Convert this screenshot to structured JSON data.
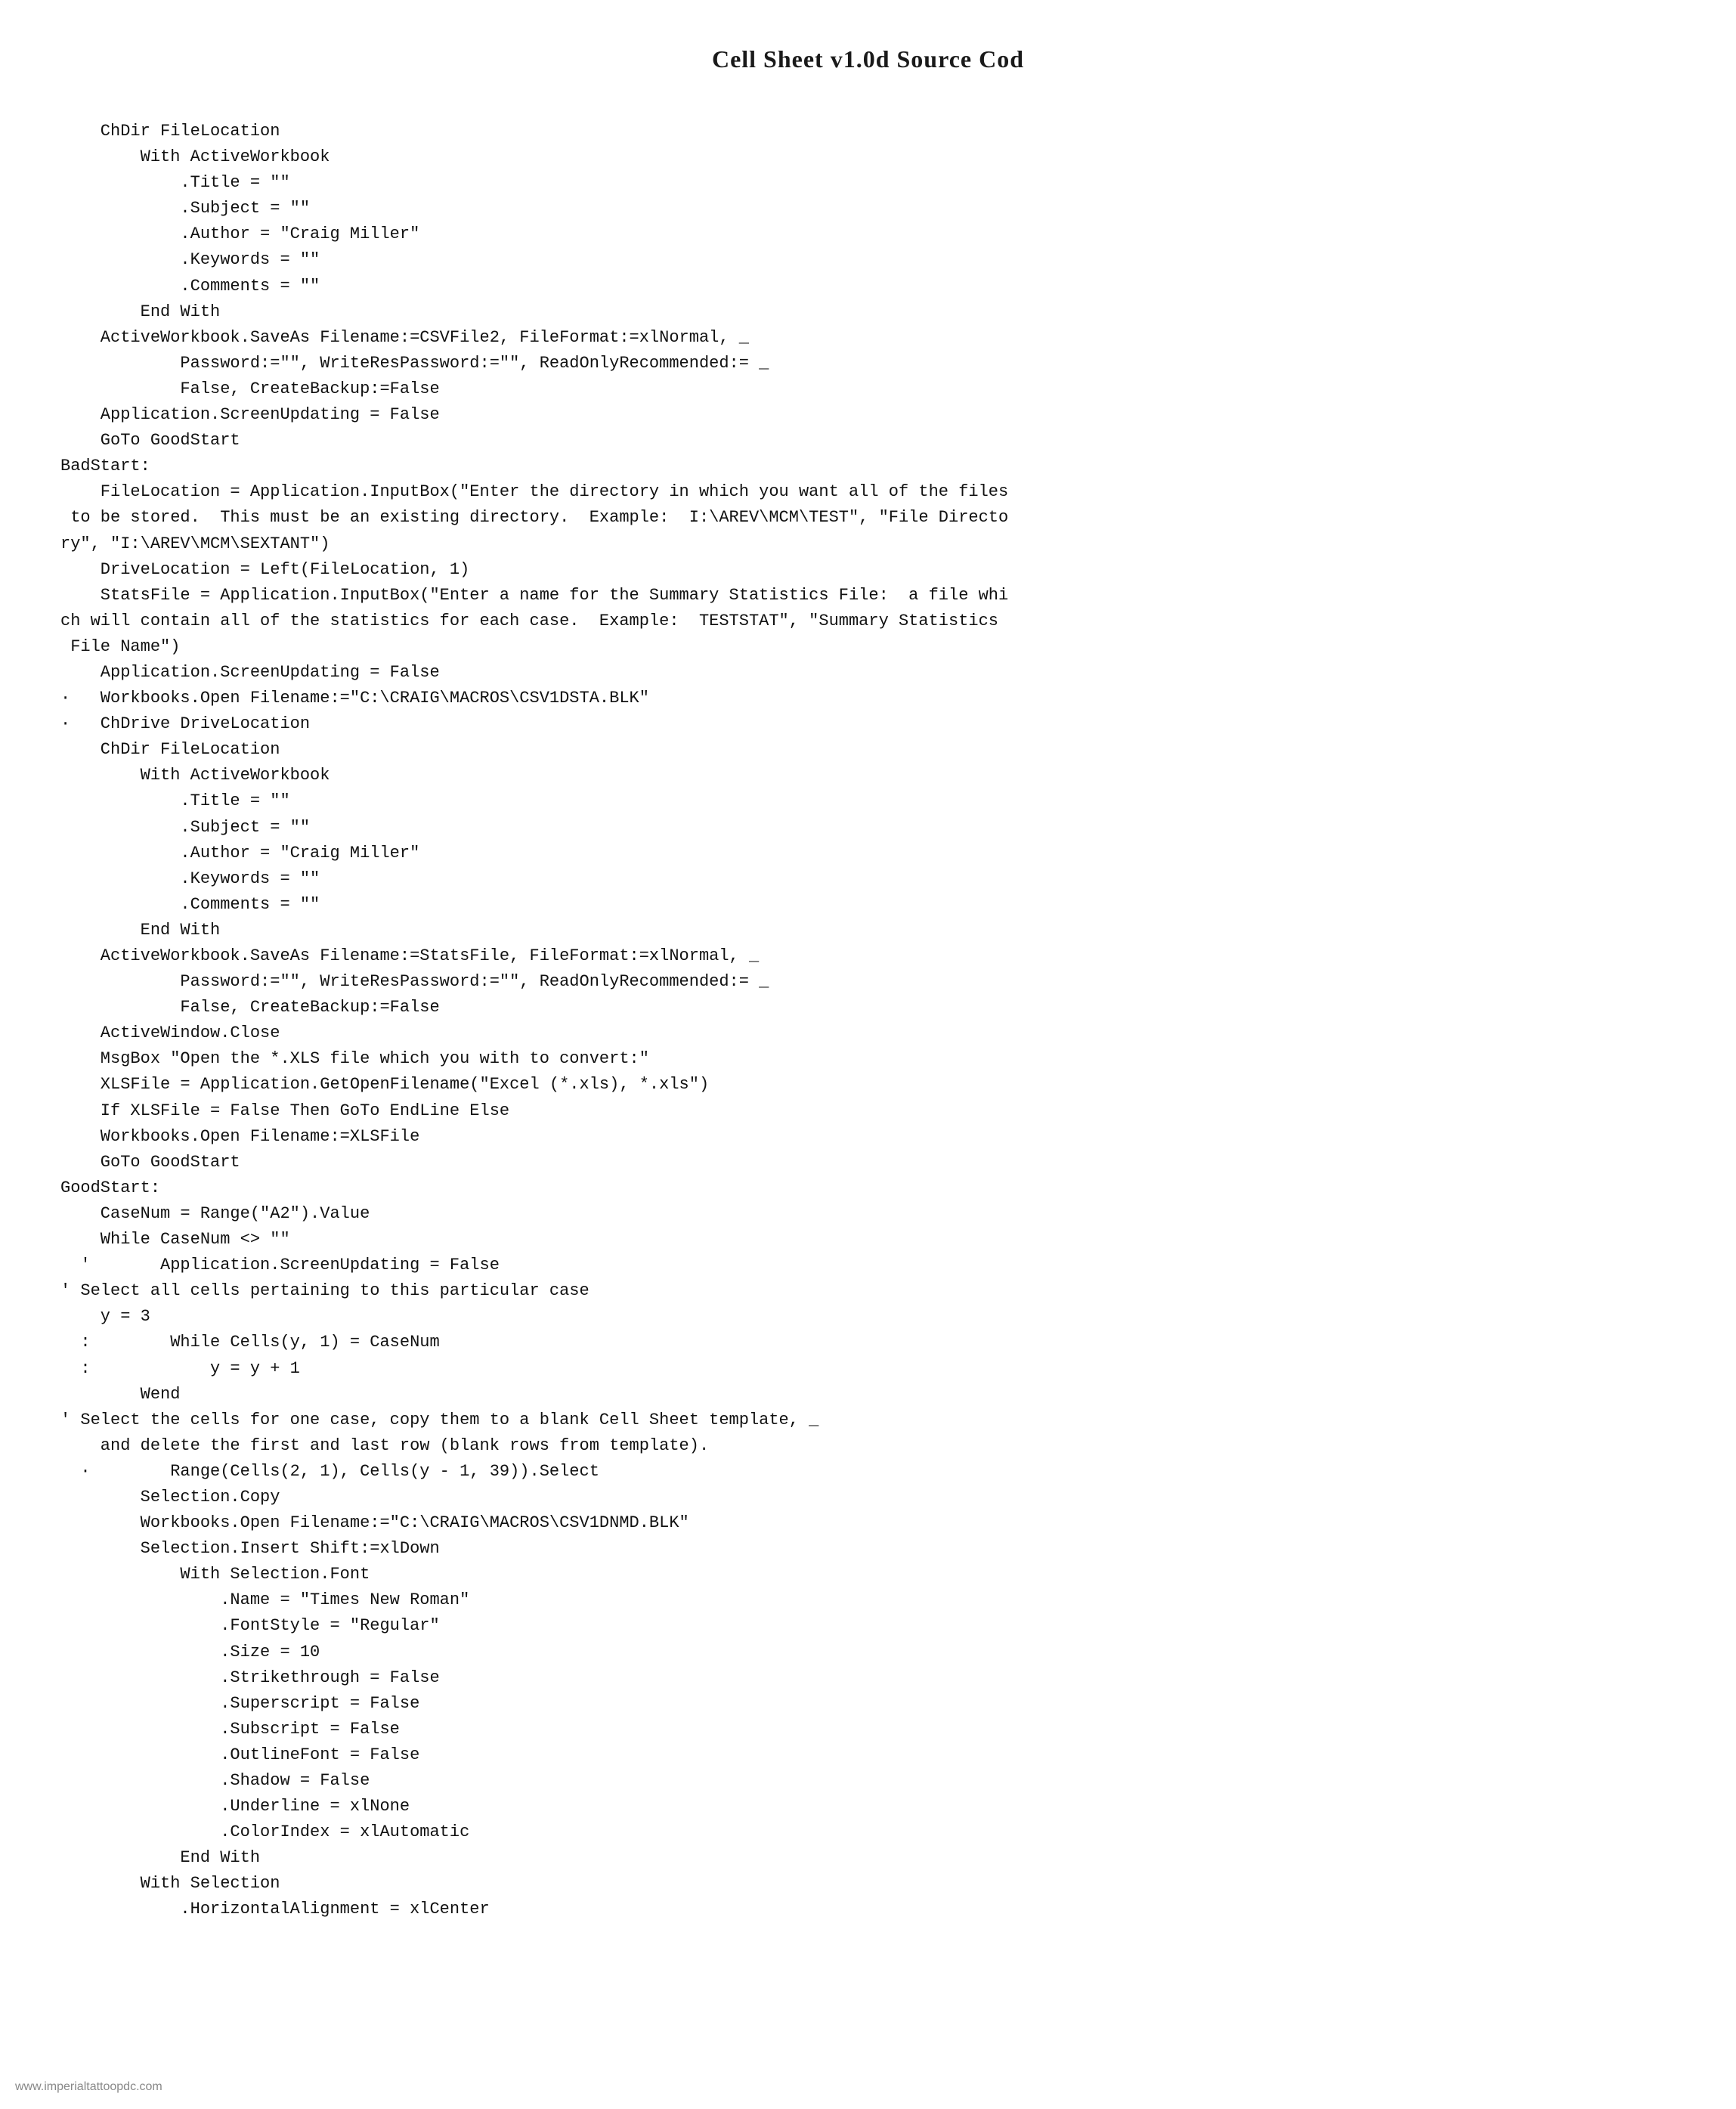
{
  "page": {
    "title": "Cell Sheet v1.0d Source Cod",
    "watermark": "www.imperialtattoopdc.com"
  },
  "code": {
    "content": "    ChDir FileLocation\n        With ActiveWorkbook\n            .Title = \"\"\n            .Subject = \"\"\n            .Author = \"Craig Miller\"\n            .Keywords = \"\"\n            .Comments = \"\"\n        End With\n    ActiveWorkbook.SaveAs Filename:=CSVFile2, FileFormat:=xlNormal, _\n            Password:=\"\", WriteResPassword:=\"\", ReadOnlyRecommended:= _\n            False, CreateBackup:=False\n    Application.ScreenUpdating = False\n    GoTo GoodStart\nBadStart:\n    FileLocation = Application.InputBox(\"Enter the directory in which you want all of the files\n to be stored.  This must be an existing directory.  Example:  I:\\AREV\\MCM\\TEST\", \"File Directo\nry\", \"I:\\AREV\\MCM\\SEXTANT\")\n    DriveLocation = Left(FileLocation, 1)\n    StatsFile = Application.InputBox(\"Enter a name for the Summary Statistics File:  a file whi\nch will contain all of the statistics for each case.  Example:  TESTSTAT\", \"Summary Statistics\n File Name\")\n    Application.ScreenUpdating = False\n·   Workbooks.Open Filename:=\"C:\\CRAIG\\MACROS\\CSV1DSTA.BLK\"\n·   ChDrive DriveLocation\n    ChDir FileLocation\n        With ActiveWorkbook\n            .Title = \"\"\n            .Subject = \"\"\n            .Author = \"Craig Miller\"\n            .Keywords = \"\"\n            .Comments = \"\"\n        End With\n    ActiveWorkbook.SaveAs Filename:=StatsFile, FileFormat:=xlNormal, _\n            Password:=\"\", WriteResPassword:=\"\", ReadOnlyRecommended:= _\n            False, CreateBackup:=False\n    ActiveWindow.Close\n    MsgBox \"Open the *.XLS file which you with to convert:\"\n    XLSFile = Application.GetOpenFilename(\"Excel (*.xls), *.xls\")\n    If XLSFile = False Then GoTo EndLine Else\n    Workbooks.Open Filename:=XLSFile\n    GoTo GoodStart\nGoodStart:\n    CaseNum = Range(\"A2\").Value\n    While CaseNum <> \"\"\n  '       Application.ScreenUpdating = False\n' Select all cells pertaining to this particular case\n    y = 3\n  :        While Cells(y, 1) = CaseNum\n  :            y = y + 1\n        Wend\n' Select the cells for one case, copy them to a blank Cell Sheet template, _\n    and delete the first and last row (blank rows from template).\n  ·        Range(Cells(2, 1), Cells(y - 1, 39)).Select\n        Selection.Copy\n        Workbooks.Open Filename:=\"C:\\CRAIG\\MACROS\\CSV1DNMD.BLK\"\n        Selection.Insert Shift:=xlDown\n            With Selection.Font\n                .Name = \"Times New Roman\"\n                .FontStyle = \"Regular\"\n                .Size = 10\n                .Strikethrough = False\n                .Superscript = False\n                .Subscript = False\n                .OutlineFont = False\n                .Shadow = False\n                .Underline = xlNone\n                .ColorIndex = xlAutomatic\n            End With\n        With Selection\n            .HorizontalAlignment = xlCenter"
  }
}
